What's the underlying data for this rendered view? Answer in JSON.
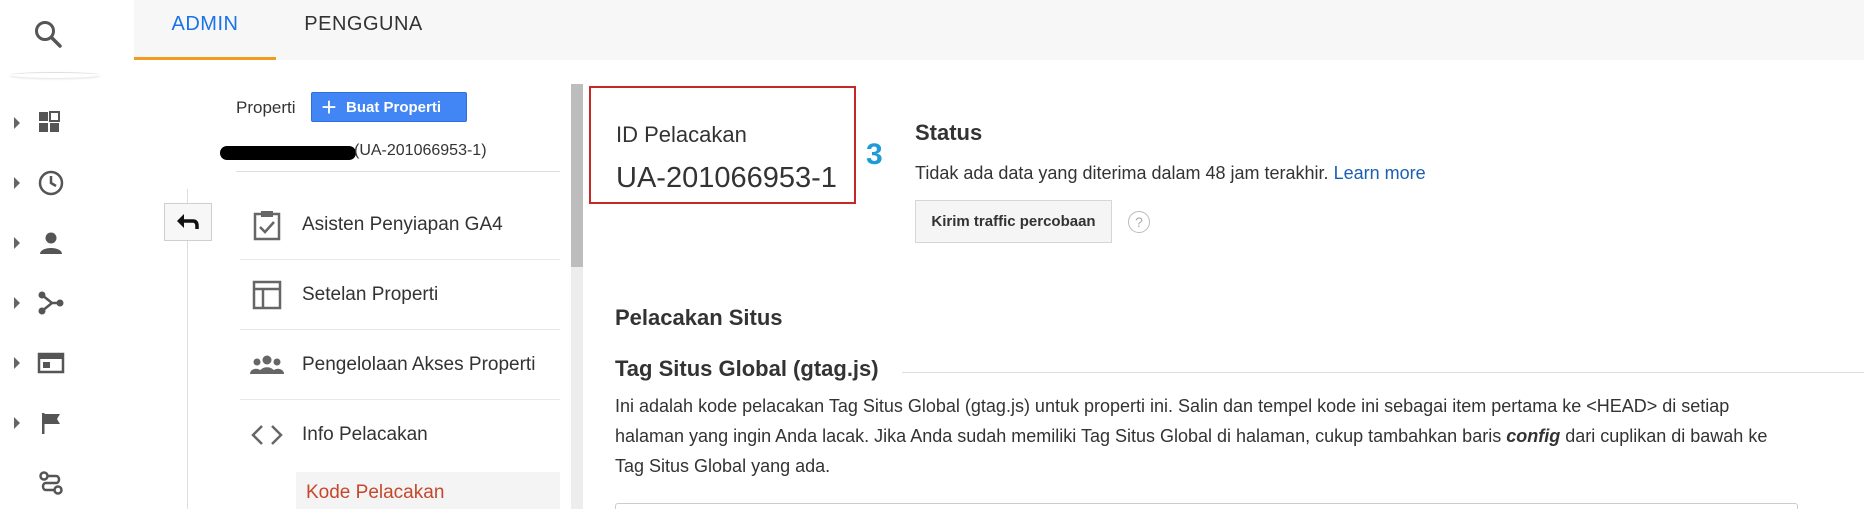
{
  "tabs": {
    "admin": "ADMIN",
    "users": "PENGGUNA"
  },
  "property": {
    "label": "Properti",
    "create_button": "Buat Properti",
    "id_display": "(UA-201066953-1)"
  },
  "nav": {
    "items": [
      {
        "label": "Asisten Penyiapan GA4",
        "icon": "clipboard-check-icon"
      },
      {
        "label": "Setelan Properti",
        "icon": "layout-icon"
      },
      {
        "label": "Pengelolaan Akses Properti",
        "icon": "people-icon"
      },
      {
        "label": "Info Pelacakan",
        "icon": "code-icon"
      }
    ],
    "sub_item": "Kode Pelacakan"
  },
  "tracking": {
    "heading": "ID Pelacakan",
    "value": "UA-201066953-1",
    "step_number": "3"
  },
  "status": {
    "heading": "Status",
    "text": "Tidak ada data yang diterima dalam 48 jam terakhir.",
    "link": "Learn more",
    "button": "Kirim traffic percobaan",
    "help": "?"
  },
  "site_tracking": {
    "heading": "Pelacakan Situs",
    "gtag_heading": "Tag Situs Global (gtag.js)",
    "line1": "Ini adalah kode pelacakan Tag Situs Global (gtag.js) untuk properti ini. Salin dan tempel kode ini sebagai item pertama ke <HEAD> di setiap",
    "line2_a": "halaman yang ingin Anda lacak. Jika Anda sudah memiliki Tag Situs Global di halaman, cukup tambahkan baris ",
    "line2_em": "config",
    "line2_b": " dari cuplikan di bawah ke",
    "line3": "Tag Situs Global yang ada."
  },
  "colors": {
    "accent_blue": "#1a73e8",
    "tab_underline": "#f29c1f",
    "create_button": "#4285f4",
    "highlight_red": "#c62828",
    "step_blue": "#1e9bd7",
    "sub_item_text": "#c5472c"
  }
}
